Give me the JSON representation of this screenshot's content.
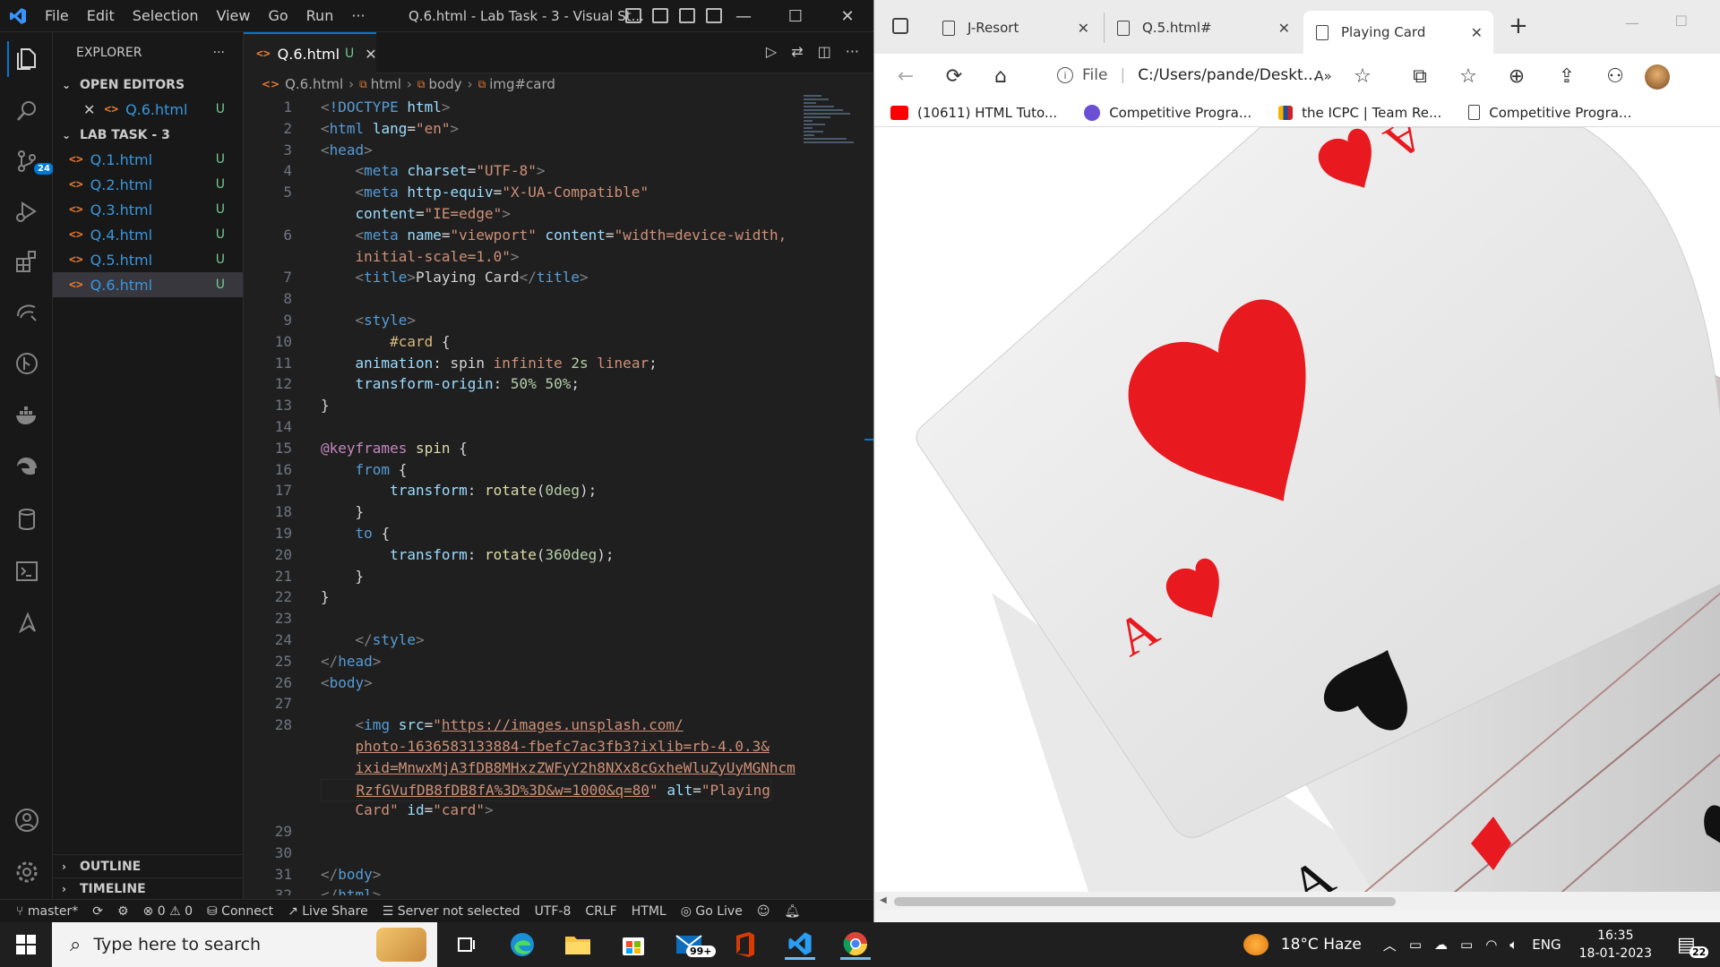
{
  "vscode": {
    "menu": [
      "File",
      "Edit",
      "Selection",
      "View",
      "Go",
      "Run",
      "···"
    ],
    "window_title": "Q.6.html - Lab Task - 3 - Visual St...",
    "explorer_title": "EXPLORER",
    "explorer_more": "···",
    "open_editors_label": "OPEN EDITORS",
    "open_editor_file": "Q.6.html",
    "folder_label": "LAB TASK - 3",
    "files": [
      "Q.1.html",
      "Q.2.html",
      "Q.3.html",
      "Q.4.html",
      "Q.5.html",
      "Q.6.html"
    ],
    "untracked_badge": "U",
    "outline_label": "OUTLINE",
    "timeline_label": "TIMELINE",
    "source_control_badge": "24",
    "tab_label": "Q.6.html",
    "breadcrumb": [
      "Q.6.html",
      "html",
      "body",
      "img#card"
    ],
    "status": {
      "branch": "master*",
      "problems": "⊗ 0 ⚠ 0",
      "connect": "Connect",
      "live_share": "Live Share",
      "server": "Server not selected",
      "encoding": "UTF-8",
      "eol": "CRLF",
      "language": "HTML",
      "go_live": "Go Live"
    },
    "line_numbers": [
      "1",
      "2",
      "3",
      "4",
      "5",
      "",
      "6",
      "",
      "7",
      "8",
      "9",
      "10",
      "11",
      "12",
      "13",
      "14",
      "15",
      "16",
      "17",
      "18",
      "19",
      "20",
      "21",
      "22",
      "23",
      "24",
      "25",
      "26",
      "27",
      "28",
      "",
      "",
      "",
      "",
      "29",
      "30",
      "31",
      "32"
    ]
  },
  "browser": {
    "tabs": [
      "J-Resort",
      "Q.5.html#",
      "Playing Card"
    ],
    "address_prefix": "File",
    "address": "C:/Users/pande/Deskt...",
    "bookmarks": [
      "(10611) HTML Tuto...",
      "Competitive Progra...",
      "the ICPC | Team Re...",
      "Competitive Progra..."
    ]
  },
  "taskbar": {
    "search_placeholder": "Type here to search",
    "mail_badge": "99+",
    "weather": "18°C  Haze",
    "language": "ENG",
    "time": "16:35",
    "date": "18-01-2023",
    "notifications": "22"
  },
  "colors": {
    "accent": "#0078d4",
    "html_orange": "#e37933",
    "untracked_green": "#73c991",
    "card_red": "#e8191f"
  }
}
